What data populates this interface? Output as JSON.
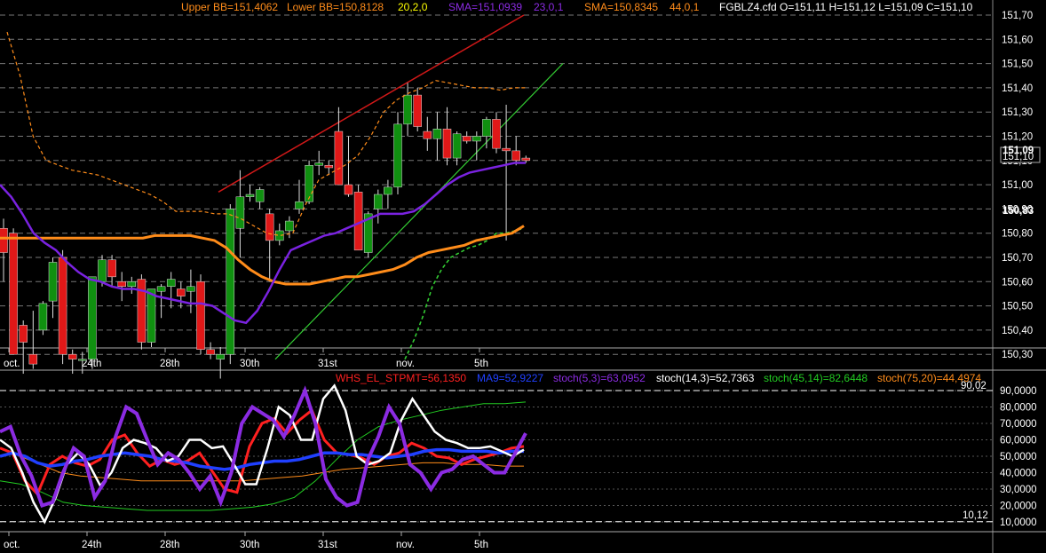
{
  "header": {
    "items": [
      {
        "text": "Upper BB=151,4062",
        "color": "#ff8c1a"
      },
      {
        "text": "Lower BB=150,8128",
        "color": "#ff8c1a"
      },
      {
        "text": "20,2,0",
        "color": "#ffff00"
      },
      {
        "text": "SMA=151,0939",
        "color": "#8b2be2"
      },
      {
        "text": "23,0,1",
        "color": "#8b2be2"
      },
      {
        "text": "SMA=150,8345",
        "color": "#ff8c1a"
      },
      {
        "text": "44,0,1",
        "color": "#ff8c1a"
      },
      {
        "text": "FGBLZ4.cfd O=151,11 H=151,12 L=151,09 C=151,10",
        "color": "#ffffff"
      }
    ]
  },
  "price_axis": {
    "labels": [
      "151,70",
      "151,60",
      "151,50",
      "151,40",
      "151,30",
      "151,20",
      "151,10",
      "151,00",
      "150,90",
      "150,80",
      "150,70",
      "150,60",
      "150,50",
      "150,40",
      "150,30"
    ],
    "current_price": "151,10",
    "sma23_tag": "151,09",
    "sma44_tag": "150,83"
  },
  "x_labels": [
    "oct.",
    "24th",
    "28th",
    "30th",
    "31st",
    "nov.",
    "5th"
  ],
  "osc_header": {
    "items": [
      {
        "text": "WHS_EL_STPMT=56,1350",
        "color": "#ff2020"
      },
      {
        "text": "MA9=52,9227",
        "color": "#2040ff"
      },
      {
        "text": "stoch(5,3)=63,0952",
        "color": "#8b2be2"
      },
      {
        "text": "stoch(14,3)=52,7363",
        "color": "#ffffff"
      },
      {
        "text": "stoch(45,14)=82,6448",
        "color": "#22cc22"
      },
      {
        "text": "stoch(75,20)=44,4974",
        "color": "#ff8c1a"
      }
    ]
  },
  "osc_axis": {
    "labels": [
      "90,0000",
      "80,0000",
      "70,0000",
      "60,0000",
      "50,0000",
      "40,0000",
      "30,0000",
      "20,0000",
      "10,0000"
    ],
    "level_high": "90,02",
    "level_low": "10,12"
  },
  "colors": {
    "bull": "#109010",
    "bear": "#e01818",
    "sma23": "#7a22e0",
    "sma44": "#ff8c1a",
    "bb": "#ff8c1a",
    "trend_red": "#d01818",
    "trend_green": "#33cc33"
  },
  "chart_data": [
    {
      "type": "candlestick",
      "title": "FGBLZ4.cfd",
      "x": [
        "oct.",
        "24th",
        "28th",
        "30th",
        "31st",
        "nov.",
        "5th"
      ],
      "ylim": [
        150.28,
        151.72
      ],
      "candles": [
        {
          "o": 150.82,
          "h": 150.86,
          "l": 150.6,
          "c": 150.72
        },
        {
          "o": 150.8,
          "h": 150.82,
          "l": 150.3,
          "c": 150.3
        },
        {
          "o": 150.42,
          "h": 150.44,
          "l": 150.22,
          "c": 150.35
        },
        {
          "o": 150.3,
          "h": 150.48,
          "l": 150.24,
          "c": 150.26
        },
        {
          "o": 150.4,
          "h": 150.52,
          "l": 150.38,
          "c": 150.51
        },
        {
          "o": 150.52,
          "h": 150.7,
          "l": 150.45,
          "c": 150.68
        },
        {
          "o": 150.7,
          "h": 150.73,
          "l": 150.26,
          "c": 150.3
        },
        {
          "o": 150.3,
          "h": 150.32,
          "l": 150.22,
          "c": 150.28
        },
        {
          "o": 150.28,
          "h": 150.31,
          "l": 150.22,
          "c": 150.28
        },
        {
          "o": 150.28,
          "h": 150.62,
          "l": 150.24,
          "c": 150.62
        },
        {
          "o": 150.6,
          "h": 150.71,
          "l": 150.58,
          "c": 150.69
        },
        {
          "o": 150.69,
          "h": 150.71,
          "l": 150.58,
          "c": 150.62
        },
        {
          "o": 150.6,
          "h": 150.64,
          "l": 150.52,
          "c": 150.58
        },
        {
          "o": 150.58,
          "h": 150.62,
          "l": 150.55,
          "c": 150.6
        },
        {
          "o": 150.61,
          "h": 150.63,
          "l": 150.32,
          "c": 150.35
        },
        {
          "o": 150.35,
          "h": 150.55,
          "l": 150.33,
          "c": 150.57
        },
        {
          "o": 150.56,
          "h": 150.59,
          "l": 150.45,
          "c": 150.58
        },
        {
          "o": 150.58,
          "h": 150.64,
          "l": 150.49,
          "c": 150.61
        },
        {
          "o": 150.57,
          "h": 150.6,
          "l": 150.49,
          "c": 150.54
        },
        {
          "o": 150.56,
          "h": 150.65,
          "l": 150.47,
          "c": 150.58
        },
        {
          "o": 150.6,
          "h": 150.63,
          "l": 150.3,
          "c": 150.32
        },
        {
          "o": 150.32,
          "h": 150.35,
          "l": 150.28,
          "c": 150.3
        },
        {
          "o": 150.28,
          "h": 150.33,
          "l": 150.2,
          "c": 150.3
        },
        {
          "o": 150.3,
          "h": 150.92,
          "l": 150.26,
          "c": 150.9
        },
        {
          "o": 150.82,
          "h": 151.06,
          "l": 150.7,
          "c": 150.95
        },
        {
          "o": 150.95,
          "h": 151.0,
          "l": 150.93,
          "c": 150.96
        },
        {
          "o": 150.93,
          "h": 150.99,
          "l": 150.9,
          "c": 150.98
        },
        {
          "o": 150.88,
          "h": 150.9,
          "l": 150.6,
          "c": 150.77
        },
        {
          "o": 150.77,
          "h": 150.84,
          "l": 150.75,
          "c": 150.81
        },
        {
          "o": 150.81,
          "h": 150.87,
          "l": 150.78,
          "c": 150.85
        },
        {
          "o": 150.9,
          "h": 151.02,
          "l": 150.88,
          "c": 150.93
        },
        {
          "o": 150.93,
          "h": 151.1,
          "l": 150.92,
          "c": 151.08
        },
        {
          "o": 151.08,
          "h": 151.14,
          "l": 151.04,
          "c": 151.09
        },
        {
          "o": 151.08,
          "h": 151.1,
          "l": 151.04,
          "c": 151.07
        },
        {
          "o": 151.22,
          "h": 151.32,
          "l": 151.0,
          "c": 151.0
        },
        {
          "o": 151.0,
          "h": 151.2,
          "l": 150.95,
          "c": 150.96
        },
        {
          "o": 150.97,
          "h": 151.0,
          "l": 150.73,
          "c": 150.73
        },
        {
          "o": 150.72,
          "h": 150.89,
          "l": 150.7,
          "c": 150.88
        },
        {
          "o": 150.9,
          "h": 150.98,
          "l": 150.84,
          "c": 150.96
        },
        {
          "o": 150.96,
          "h": 151.02,
          "l": 150.9,
          "c": 150.99
        },
        {
          "o": 150.99,
          "h": 151.3,
          "l": 150.96,
          "c": 151.25
        },
        {
          "o": 151.25,
          "h": 151.42,
          "l": 151.2,
          "c": 151.37
        },
        {
          "o": 151.37,
          "h": 151.4,
          "l": 151.22,
          "c": 151.24
        },
        {
          "o": 151.22,
          "h": 151.28,
          "l": 151.14,
          "c": 151.19
        },
        {
          "o": 151.19,
          "h": 151.3,
          "l": 151.1,
          "c": 151.23
        },
        {
          "o": 151.23,
          "h": 151.32,
          "l": 151.08,
          "c": 151.11
        },
        {
          "o": 151.11,
          "h": 151.22,
          "l": 151.08,
          "c": 151.21
        },
        {
          "o": 151.2,
          "h": 151.22,
          "l": 151.17,
          "c": 151.18
        },
        {
          "o": 151.18,
          "h": 151.22,
          "l": 151.1,
          "c": 151.2
        },
        {
          "o": 151.2,
          "h": 151.28,
          "l": 151.15,
          "c": 151.27
        },
        {
          "o": 151.27,
          "h": 151.3,
          "l": 151.13,
          "c": 151.15
        },
        {
          "o": 151.15,
          "h": 151.33,
          "l": 150.77,
          "c": 151.14
        },
        {
          "o": 151.14,
          "h": 151.2,
          "l": 151.08,
          "c": 151.1
        },
        {
          "o": 151.11,
          "h": 151.12,
          "l": 151.09,
          "c": 151.1
        }
      ],
      "series": [
        {
          "values": [
            151.0,
            150.95,
            150.88,
            150.8,
            150.76,
            150.73,
            150.68,
            150.64,
            150.61,
            150.6,
            150.58,
            150.57,
            150.57,
            150.56,
            150.54,
            150.53,
            150.52,
            150.51,
            150.51,
            150.5,
            150.47,
            150.44,
            150.43,
            150.48,
            150.56,
            150.65,
            150.73,
            150.75,
            150.77,
            150.79,
            150.8,
            150.82,
            150.84,
            150.86,
            150.88,
            150.88,
            150.88,
            150.89,
            150.92,
            150.96,
            151.0,
            151.03,
            151.05,
            151.06,
            151.07,
            151.08,
            151.09,
            151.09
          ]
        },
        {
          "values": [
            150.78,
            150.78,
            150.78,
            150.78,
            150.78,
            150.78,
            150.78,
            150.78,
            150.78,
            150.78,
            150.78,
            150.78,
            150.78,
            150.79,
            150.79,
            150.79,
            150.79,
            150.78,
            150.77,
            150.74,
            150.69,
            150.65,
            150.62,
            150.6,
            150.59,
            150.59,
            150.59,
            150.6,
            150.61,
            150.62,
            150.62,
            150.63,
            150.64,
            150.65,
            150.67,
            150.7,
            150.72,
            150.73,
            150.74,
            150.75,
            150.77,
            150.78,
            150.79,
            150.8,
            150.83
          ]
        },
        {
          "values": [
            151.63,
            151.45,
            151.2,
            151.1,
            151.08,
            151.06,
            151.05,
            151.04,
            151.02,
            151.0,
            150.98,
            150.96,
            150.93,
            150.89,
            150.89,
            150.89,
            150.88,
            150.88,
            150.86,
            150.83,
            150.8,
            150.79,
            150.8,
            150.92,
            151.02,
            151.05,
            151.08,
            151.12,
            151.2,
            151.3,
            151.35,
            151.38,
            151.4,
            151.43,
            151.42,
            151.41,
            151.4,
            151.4,
            151.39,
            151.4,
            151.4
          ]
        },
        {
          "values": [
            150.28,
            150.36,
            150.46,
            150.58,
            150.65,
            150.7,
            150.72,
            150.74,
            150.75,
            150.77,
            150.8,
            150.8,
            150.81,
            150.82
          ]
        }
      ]
    },
    {
      "type": "line",
      "x": [
        "oct.",
        "24th",
        "28th",
        "30th",
        "31st",
        "nov.",
        "5th"
      ],
      "ylim": [
        5,
        95
      ],
      "series": [
        {
          "values": [
            55,
            52,
            35,
            27,
            45,
            50,
            46,
            44,
            48,
            60,
            63,
            52,
            44,
            48,
            45,
            47,
            52,
            41,
            30,
            28,
            56,
            70,
            73,
            64,
            72,
            78,
            60,
            52,
            51,
            49,
            45,
            50,
            52,
            58,
            55,
            50,
            49,
            45,
            48,
            50,
            52,
            55,
            56
          ]
        },
        {
          "values": [
            50,
            52,
            50,
            46,
            44,
            45,
            47,
            48,
            50,
            51,
            52,
            51,
            50,
            48,
            47,
            46,
            44,
            43,
            42,
            43,
            45,
            46,
            47,
            47,
            48,
            50,
            52,
            52,
            51,
            51,
            50,
            49,
            50,
            51,
            53,
            54,
            54,
            53,
            53,
            53,
            52,
            53,
            53
          ]
        },
        {
          "values": [
            65,
            68,
            50,
            38,
            20,
            22,
            40,
            55,
            50,
            25,
            35,
            62,
            80,
            76,
            60,
            45,
            52,
            48,
            40,
            30,
            38,
            22,
            40,
            70,
            80,
            76,
            72,
            62,
            75,
            90,
            70,
            36,
            25,
            20,
            22,
            48,
            62,
            80,
            70,
            45,
            40,
            30,
            40,
            42,
            48,
            50,
            45,
            40,
            40,
            52,
            64
          ]
        },
        {
          "values": [
            60,
            55,
            40,
            22,
            10,
            25,
            45,
            52,
            45,
            32,
            40,
            55,
            60,
            58,
            55,
            47,
            50,
            60,
            60,
            55,
            56,
            45,
            33,
            33,
            55,
            80,
            75,
            60,
            60,
            85,
            93,
            78,
            50,
            45,
            47,
            52,
            72,
            85,
            75,
            65,
            60,
            58,
            55,
            55,
            56,
            53,
            50,
            54
          ]
        },
        {
          "values": [
            35,
            33,
            28,
            22,
            20,
            19,
            18,
            17,
            17,
            17,
            17,
            18,
            19,
            21,
            25,
            35,
            48,
            60,
            68,
            72,
            75,
            78,
            80,
            82,
            82,
            83
          ]
        },
        {
          "values": [
            55,
            50,
            45,
            40,
            38,
            37,
            36,
            35,
            35,
            35,
            35,
            35,
            35,
            36,
            37,
            38,
            40,
            42,
            43,
            44,
            45,
            46,
            46,
            45,
            45,
            44,
            44
          ]
        }
      ]
    }
  ]
}
